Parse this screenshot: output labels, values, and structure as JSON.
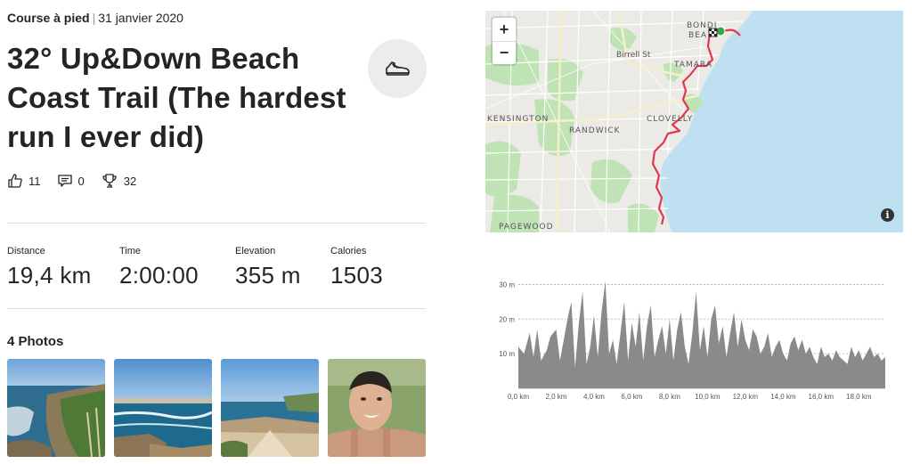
{
  "activity": {
    "type": "Course à pied",
    "date": "31 janvier 2020",
    "title": "32° Up&Down Beach Coast Trail (The hardest run I ever did)",
    "icon": "running-shoe-icon"
  },
  "social": {
    "kudos": "11",
    "comments": "0",
    "achievements": "32"
  },
  "stats": [
    {
      "label": "Distance",
      "value": "19,4 km"
    },
    {
      "label": "Time",
      "value": "2:00:00"
    },
    {
      "label": "Elevation",
      "value": "355 m"
    },
    {
      "label": "Calories",
      "value": "1503"
    }
  ],
  "photos": {
    "title": "4 Photos",
    "items": [
      "coastal-cliffs-photo",
      "bondi-beach-photo",
      "coast-walk-photo",
      "selfie-photo"
    ]
  },
  "map": {
    "zoom_in": "+",
    "zoom_out": "−",
    "info": "i",
    "labels": {
      "bondi": "BONDI",
      "beach": "BEA",
      "birrell": "Birrell St",
      "tamarama": "TAMARA",
      "kensington": "KENSINGTON",
      "randwick": "RANDWICK",
      "clovelly": "CLOVELLY",
      "pagewood": "PAGEWOOD"
    },
    "colors": {
      "route": "#e0384f",
      "water": "#bfe0f0",
      "park": "#bfe3b4",
      "land": "#ebeae6"
    }
  },
  "chart_data": {
    "type": "area",
    "xlabel": "",
    "ylabel": "",
    "x_ticks": [
      "0,0 km",
      "2,0 km",
      "4,0 km",
      "6,0 km",
      "8,0 km",
      "10,0 km",
      "12,0 km",
      "14,0 km",
      "16,0 km",
      "18,0 km"
    ],
    "y_ticks": [
      "10 m",
      "20 m",
      "30 m"
    ],
    "xlim": [
      0,
      19.4
    ],
    "ylim": [
      0,
      35
    ],
    "grid": true,
    "color": "#8a8a8a",
    "series": [
      {
        "x": [
          0,
          0.3,
          0.6,
          0.8,
          1.0,
          1.2,
          1.5,
          1.7,
          2.0,
          2.2,
          2.4,
          2.6,
          2.8,
          3.0,
          3.2,
          3.4,
          3.6,
          3.8,
          4.0,
          4.2,
          4.4,
          4.6,
          4.8,
          5.0,
          5.2,
          5.4,
          5.6,
          5.8,
          6.0,
          6.2,
          6.4,
          6.6,
          6.8,
          7.0,
          7.2,
          7.4,
          7.6,
          7.8,
          8.0,
          8.2,
          8.4,
          8.6,
          8.8,
          9.0,
          9.2,
          9.4,
          9.6,
          9.8,
          10.0,
          10.2,
          10.4,
          10.6,
          10.8,
          11.0,
          11.2,
          11.4,
          11.6,
          11.8,
          12.0,
          12.2,
          12.4,
          12.6,
          12.8,
          13.0,
          13.2,
          13.4,
          13.6,
          13.8,
          14.0,
          14.2,
          14.4,
          14.6,
          14.8,
          15.0,
          15.2,
          15.4,
          15.6,
          15.8,
          16.0,
          16.2,
          16.4,
          16.6,
          16.8,
          17.0,
          17.2,
          17.4,
          17.6,
          17.8,
          18.0,
          18.2,
          18.4,
          18.6,
          18.8,
          19.0,
          19.2,
          19.4
        ],
        "y": [
          12,
          10,
          16,
          9,
          17,
          8,
          11,
          15,
          17,
          8,
          14,
          20,
          25,
          6,
          19,
          28,
          7,
          12,
          21,
          9,
          22,
          31,
          10,
          14,
          7,
          16,
          25,
          8,
          19,
          12,
          22,
          8,
          18,
          24,
          9,
          14,
          18,
          10,
          20,
          8,
          17,
          22,
          12,
          7,
          16,
          28,
          11,
          18,
          9,
          20,
          24,
          13,
          18,
          9,
          16,
          22,
          12,
          20,
          14,
          11,
          17,
          15,
          10,
          12,
          16,
          9,
          12,
          14,
          10,
          8,
          13,
          15,
          11,
          14,
          10,
          12,
          9,
          7,
          12,
          9,
          10,
          8,
          11,
          9,
          8,
          7,
          12,
          9,
          11,
          8,
          10,
          12,
          9,
          10,
          8,
          9
        ]
      }
    ]
  }
}
